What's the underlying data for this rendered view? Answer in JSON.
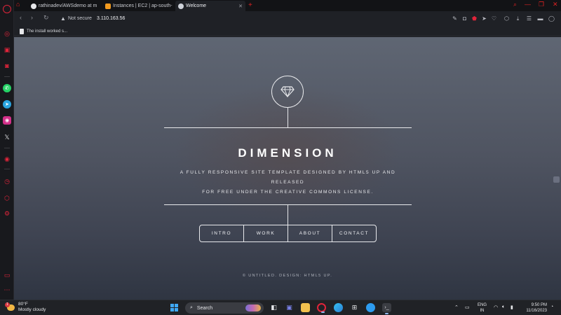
{
  "browser": {
    "tabs": [
      {
        "title": "rathinadev/AWSdemo at m",
        "favicon": "github-icon",
        "active": false
      },
      {
        "title": "Instances | EC2 | ap-south-",
        "favicon": "aws-icon",
        "active": false
      },
      {
        "title": "Welcome",
        "favicon": "globe-icon",
        "active": true
      }
    ],
    "security_label": "Not secure",
    "url": "3.110.163.56",
    "bookmark": "The install worked s..."
  },
  "page": {
    "title": "DIMENSION",
    "description_line1": "A FULLY RESPONSIVE SITE TEMPLATE DESIGNED BY HTML5 UP AND RELEASED",
    "description_line2": "FOR FREE UNDER THE CREATIVE COMMONS LICENSE.",
    "nav": [
      "INTRO",
      "WORK",
      "ABOUT",
      "CONTACT"
    ],
    "footer": "© UNTITLED. DESIGN: HTML5 UP."
  },
  "taskbar": {
    "weather_temp": "80°F",
    "weather_desc": "Mostly cloudy",
    "weather_badge": "1",
    "search_label": "Search",
    "lang_line1": "ENG",
    "lang_line2": "IN",
    "time": "9:50 PM",
    "date": "11/16/2023"
  },
  "colors": {
    "opera_red": "#e0243a",
    "page_text": "#ffffff",
    "taskbar_bg": "#202226"
  }
}
